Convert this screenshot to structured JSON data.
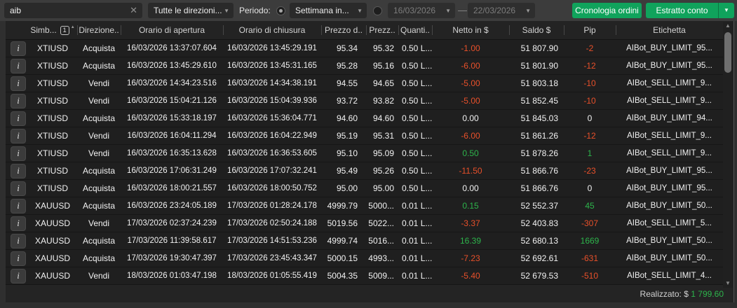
{
  "toolbar": {
    "search_value": "aib",
    "direction_filter": "Tutte le direzioni...",
    "period_label": "Periodo:",
    "period_preset": "Settimana in...",
    "date_from": "16/03/2026",
    "date_separator": "—",
    "date_to": "22/03/2026",
    "history_button": "Cronologia ordini",
    "statement_button": "Estratto conto"
  },
  "table": {
    "sort_badge": "1",
    "columns": [
      "Simb...",
      "Direzione..",
      "Orario di apertura",
      "Orario di chiusura",
      "Prezzo d..",
      "Prezz..",
      "Quanti..",
      "Netto in $",
      "Saldo $",
      "Pip",
      "Etichetta"
    ],
    "rows": [
      {
        "symbol": "XTIUSD",
        "direction": "Acquista",
        "open_time": "16/03/2026 13:37:07.604",
        "close_time": "16/03/2026 13:45:29.191",
        "open_price": "95.34",
        "close_price": "95.32",
        "quantity": "0.50 L...",
        "net": "-1.00",
        "balance": "51 807.90",
        "pip": "-2",
        "label": "AIBot_BUY_LIMIT_95..."
      },
      {
        "symbol": "XTIUSD",
        "direction": "Acquista",
        "open_time": "16/03/2026 13:45:29.610",
        "close_time": "16/03/2026 13:45:31.165",
        "open_price": "95.28",
        "close_price": "95.16",
        "quantity": "0.50 L...",
        "net": "-6.00",
        "balance": "51 801.90",
        "pip": "-12",
        "label": "AIBot_BUY_LIMIT_95..."
      },
      {
        "symbol": "XTIUSD",
        "direction": "Vendi",
        "open_time": "16/03/2026 14:34:23.516",
        "close_time": "16/03/2026 14:34:38.191",
        "open_price": "94.55",
        "close_price": "94.65",
        "quantity": "0.50 L...",
        "net": "-5.00",
        "balance": "51 803.18",
        "pip": "-10",
        "label": "AIBot_SELL_LIMIT_9..."
      },
      {
        "symbol": "XTIUSD",
        "direction": "Vendi",
        "open_time": "16/03/2026 15:04:21.126",
        "close_time": "16/03/2026 15:04:39.936",
        "open_price": "93.72",
        "close_price": "93.82",
        "quantity": "0.50 L...",
        "net": "-5.00",
        "balance": "51 852.45",
        "pip": "-10",
        "label": "AIBot_SELL_LIMIT_9..."
      },
      {
        "symbol": "XTIUSD",
        "direction": "Acquista",
        "open_time": "16/03/2026 15:33:18.197",
        "close_time": "16/03/2026 15:36:04.771",
        "open_price": "94.60",
        "close_price": "94.60",
        "quantity": "0.50 L...",
        "net": "0.00",
        "balance": "51 845.03",
        "pip": "0",
        "label": "AIBot_BUY_LIMIT_94..."
      },
      {
        "symbol": "XTIUSD",
        "direction": "Vendi",
        "open_time": "16/03/2026 16:04:11.294",
        "close_time": "16/03/2026 16:04:22.949",
        "open_price": "95.19",
        "close_price": "95.31",
        "quantity": "0.50 L...",
        "net": "-6.00",
        "balance": "51 861.26",
        "pip": "-12",
        "label": "AIBot_SELL_LIMIT_9..."
      },
      {
        "symbol": "XTIUSD",
        "direction": "Vendi",
        "open_time": "16/03/2026 16:35:13.628",
        "close_time": "16/03/2026 16:36:53.605",
        "open_price": "95.10",
        "close_price": "95.09",
        "quantity": "0.50 L...",
        "net": "0.50",
        "balance": "51 878.26",
        "pip": "1",
        "label": "AIBot_SELL_LIMIT_9..."
      },
      {
        "symbol": "XTIUSD",
        "direction": "Acquista",
        "open_time": "16/03/2026 17:06:31.249",
        "close_time": "16/03/2026 17:07:32.241",
        "open_price": "95.49",
        "close_price": "95.26",
        "quantity": "0.50 L...",
        "net": "-11.50",
        "balance": "51 866.76",
        "pip": "-23",
        "label": "AIBot_BUY_LIMIT_95..."
      },
      {
        "symbol": "XTIUSD",
        "direction": "Acquista",
        "open_time": "16/03/2026 18:00:21.557",
        "close_time": "16/03/2026 18:00:50.752",
        "open_price": "95.00",
        "close_price": "95.00",
        "quantity": "0.50 L...",
        "net": "0.00",
        "balance": "51 866.76",
        "pip": "0",
        "label": "AIBot_BUY_LIMIT_95..."
      },
      {
        "symbol": "XAUUSD",
        "direction": "Acquista",
        "open_time": "16/03/2026 23:24:05.189",
        "close_time": "17/03/2026 01:28:24.178",
        "open_price": "4999.79",
        "close_price": "5000...",
        "quantity": "0.01 L...",
        "net": "0.15",
        "balance": "52 552.37",
        "pip": "45",
        "label": "AIBot_BUY_LIMIT_50..."
      },
      {
        "symbol": "XAUUSD",
        "direction": "Vendi",
        "open_time": "17/03/2026 02:37:24.239",
        "close_time": "17/03/2026 02:50:24.188",
        "open_price": "5019.56",
        "close_price": "5022...",
        "quantity": "0.01 L...",
        "net": "-3.37",
        "balance": "52 403.83",
        "pip": "-307",
        "label": "AIBot_SELL_LIMIT_5..."
      },
      {
        "symbol": "XAUUSD",
        "direction": "Acquista",
        "open_time": "17/03/2026 11:39:58.617",
        "close_time": "17/03/2026 14:51:53.236",
        "open_price": "4999.74",
        "close_price": "5016...",
        "quantity": "0.01 L...",
        "net": "16.39",
        "balance": "52 680.13",
        "pip": "1669",
        "label": "AIBot_BUY_LIMIT_50..."
      },
      {
        "symbol": "XAUUSD",
        "direction": "Acquista",
        "open_time": "17/03/2026 19:30:47.397",
        "close_time": "17/03/2026 23:45:43.347",
        "open_price": "5000.15",
        "close_price": "4993...",
        "quantity": "0.01 L...",
        "net": "-7.23",
        "balance": "52 692.61",
        "pip": "-631",
        "label": "AIBot_BUY_LIMIT_50..."
      },
      {
        "symbol": "XAUUSD",
        "direction": "Vendi",
        "open_time": "18/03/2026 01:03:47.198",
        "close_time": "18/03/2026 01:05:55.419",
        "open_price": "5004.35",
        "close_price": "5009...",
        "quantity": "0.01 L...",
        "net": "-5.40",
        "balance": "52 679.53",
        "pip": "-510",
        "label": "AIBot_SELL_LIMIT_4..."
      }
    ]
  },
  "footer": {
    "realized_label": "Realizzato:",
    "currency": "$",
    "realized_value": "1 799.60"
  },
  "colors": {
    "positive": "#2db44b",
    "negative": "#e8502a",
    "accent_green": "#10a35c"
  }
}
